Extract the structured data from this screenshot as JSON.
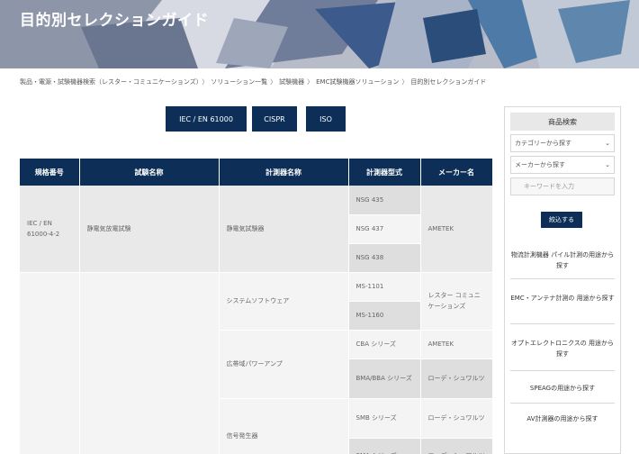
{
  "header": {
    "title": "目的別セレクションガイド"
  },
  "breadcrumb": [
    "製品・電源・試験機器検索（レスター・コミュニケーションズ）",
    "ソリューション一覧",
    "試験機器",
    "EMC試験機器ソリューション",
    "目的別セレクションガイド"
  ],
  "filters": [
    {
      "label": "IEC / EN 61000"
    },
    {
      "label": "CISPR"
    },
    {
      "label": "ISO"
    }
  ],
  "table": {
    "headers": [
      "規格番号",
      "試験名称",
      "計測器名称",
      "計測器型式",
      "メーカー名"
    ],
    "group1": {
      "standard": "IEC / EN 61000-4-2",
      "test": "静電気放電試験",
      "instrument": "静電気試験器",
      "models": [
        "NSG 435",
        "NSG 437",
        "NSG 438"
      ],
      "maker": "AMETEK"
    },
    "group2": {
      "instruments": [
        "システムソフトウェア",
        "広帯域パワーアンプ",
        "信号発生器"
      ],
      "models": [
        "MS-1101",
        "MS-1160",
        "CBA シリーズ",
        "BMA/BBA シリーズ",
        "SMB シリーズ",
        "SMA シリーズ"
      ],
      "makers": [
        "レスター コミュニケーションズ",
        "AMETEK",
        "ローデ・シュワルツ",
        "ローデ・シュワルツ",
        "ローデ・シュワルツ"
      ]
    }
  },
  "sidebar": {
    "title": "商品検索",
    "category_select": "カテゴリーから探す",
    "maker_select": "メーカーから探す",
    "keyword_placeholder": "キーワードを入力",
    "search_button": "絞込する",
    "links": [
      "物流計測機器 パイル計測の用途から探す",
      "EMC・アンテナ計測の 用途から探す",
      "オプトエレクトロニクスの 用途から探す",
      "SPEAGの用途から探す",
      "AV計測器の用途から探す"
    ]
  },
  "colors": {
    "navy": "#0d2f57",
    "cell_gray": "#e9e9e9"
  }
}
